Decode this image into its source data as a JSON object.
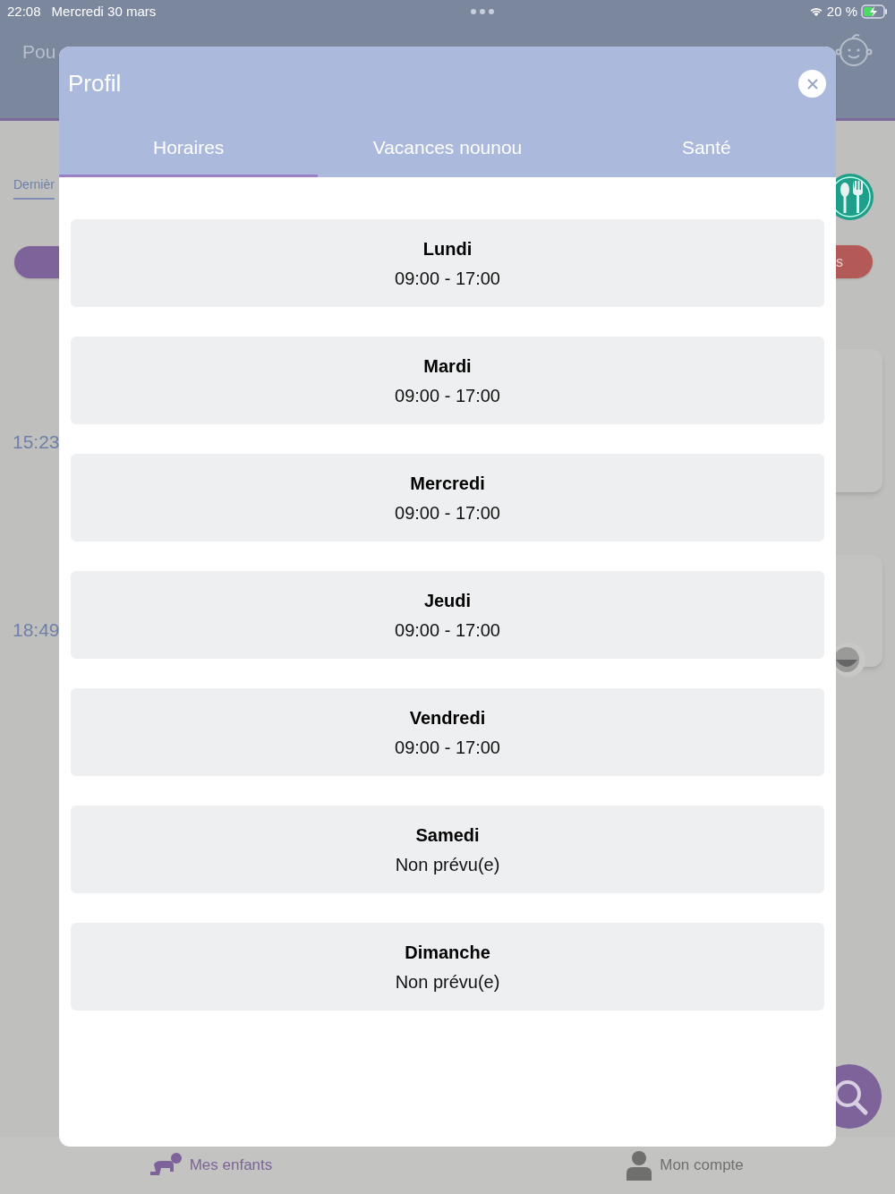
{
  "status_bar": {
    "time": "22:08",
    "date": "Mercredi 30 mars",
    "battery": "20 %"
  },
  "background": {
    "app_title": "Pou",
    "section_tab": "Dernièr",
    "red_button_label": "s",
    "times": [
      "15:23",
      "18:49"
    ]
  },
  "tab_bar": [
    {
      "label": "Mes enfants",
      "selected": true
    },
    {
      "label": "Mon compte",
      "selected": false
    }
  ],
  "modal": {
    "title": "Profil",
    "tabs": [
      {
        "label": "Horaires",
        "selected": true
      },
      {
        "label": "Vacances nounou",
        "selected": false
      },
      {
        "label": "Santé",
        "selected": false
      }
    ],
    "schedule": [
      {
        "day": "Lundi",
        "hours": "09:00 - 17:00"
      },
      {
        "day": "Mardi",
        "hours": "09:00 - 17:00"
      },
      {
        "day": "Mercredi",
        "hours": "09:00 - 17:00"
      },
      {
        "day": "Jeudi",
        "hours": "09:00 - 17:00"
      },
      {
        "day": "Vendredi",
        "hours": "09:00 - 17:00"
      },
      {
        "day": "Samedi",
        "hours": "Non prévu(e)"
      },
      {
        "day": "Dimanche",
        "hours": "Non prévu(e)"
      }
    ]
  }
}
